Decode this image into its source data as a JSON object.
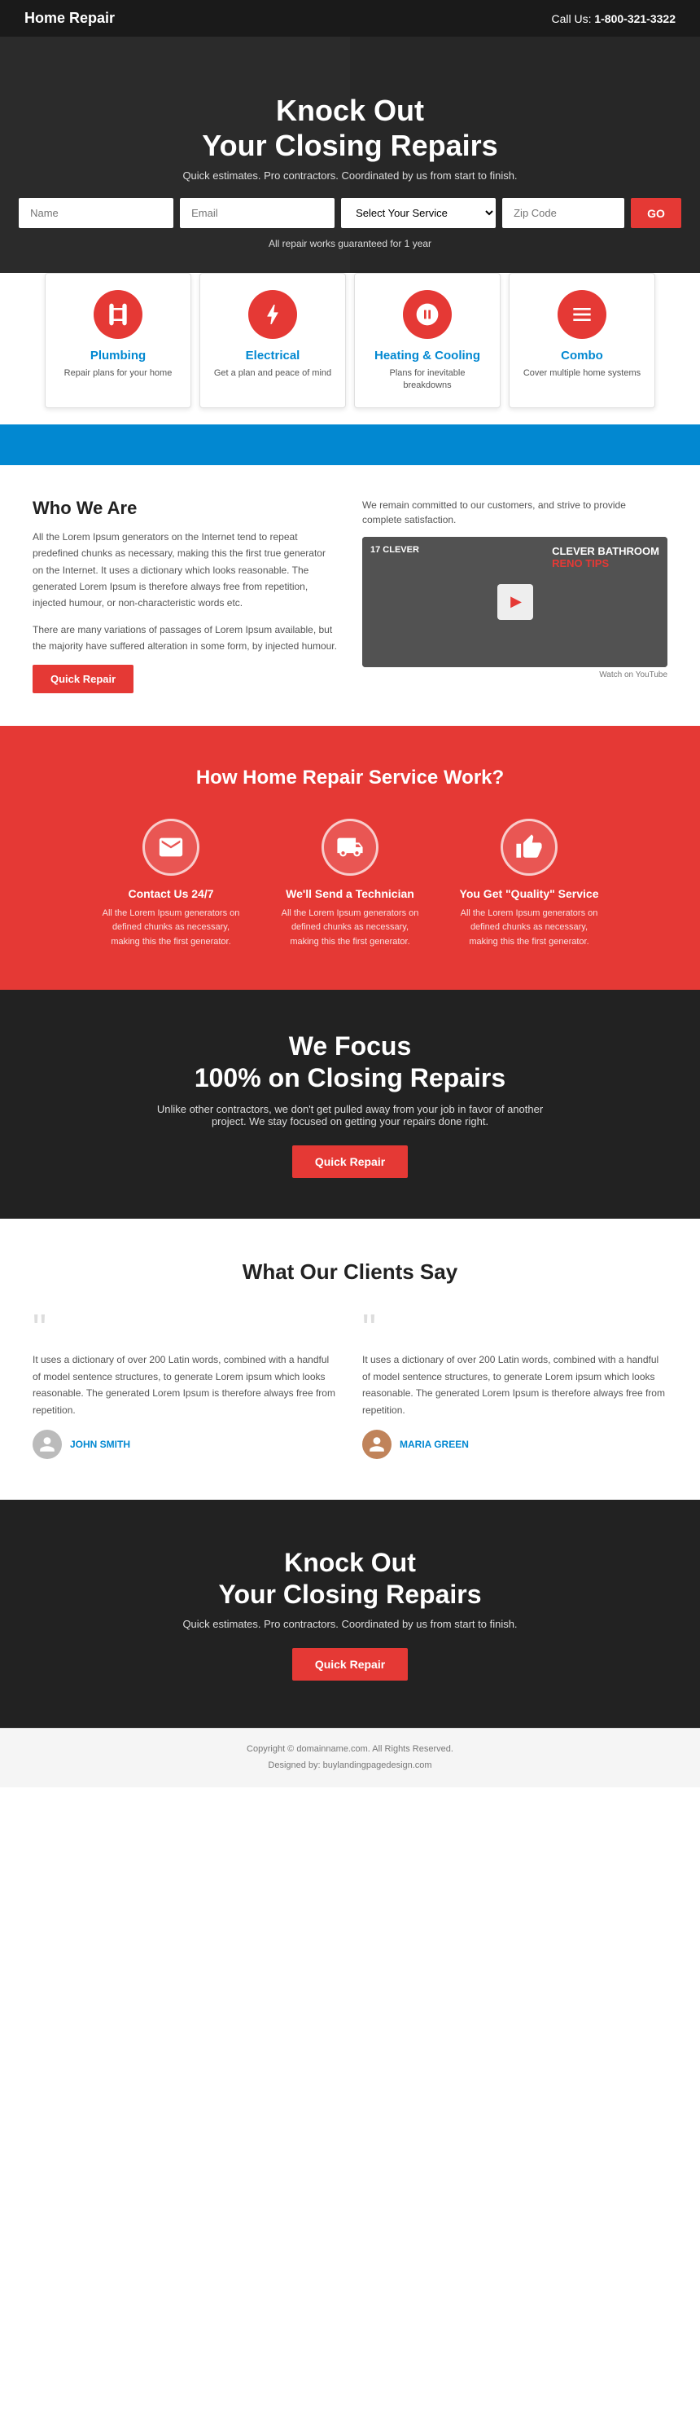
{
  "header": {
    "logo": "Home Repair",
    "phone_label": "Call Us:",
    "phone": "1-800-321-3322"
  },
  "hero": {
    "title_line1": "Knock Out",
    "title_line2": "Your Closing Repairs",
    "subtitle": "Quick estimates. Pro contractors. Coordinated by us from start to finish.",
    "name_placeholder": "Name",
    "email_placeholder": "Email",
    "service_placeholder": "Select Your Service",
    "zip_placeholder": "Zip Code",
    "go_label": "GO",
    "guarantee": "All repair works guaranteed for 1 year"
  },
  "services": [
    {
      "title": "Plumbing",
      "desc": "Repair plans for your home",
      "icon": "plumbing"
    },
    {
      "title": "Electrical",
      "desc": "Get a plan and peace of mind",
      "icon": "electrical"
    },
    {
      "title": "Heating & Cooling",
      "desc": "Plans for inevitable breakdowns",
      "icon": "hvac"
    },
    {
      "title": "Combo",
      "desc": "Cover multiple home systems",
      "icon": "combo"
    }
  ],
  "who": {
    "title": "Who We Are",
    "para1": "All the Lorem Ipsum generators on the Internet tend to repeat predefined chunks as necessary, making this the first true generator on the Internet. It uses a dictionary which looks reasonable. The generated Lorem Ipsum is therefore always free from repetition, injected humour, or non-characteristic words etc.",
    "para2": "There are many variations of passages of Lorem Ipsum available, but the majority have suffered alteration in some form, by injected humour.",
    "btn_label": "Quick Repair",
    "right_text": "We remain committed to our customers, and strive to provide complete satisfaction.",
    "video_label": "17 Clever",
    "video_reno": "RENO TIPS",
    "video_footer": "Watch on YouTube"
  },
  "how": {
    "title": "How Home Repair Service Work?",
    "steps": [
      {
        "title": "Contact Us 24/7",
        "desc": "All the Lorem Ipsum generators on defined chunks as necessary, making this the first generator.",
        "icon": "envelope"
      },
      {
        "title": "We'll Send a Technician",
        "desc": "All the Lorem Ipsum generators on defined chunks as necessary, making this the first generator.",
        "icon": "truck"
      },
      {
        "title": "You Get \"Quality\" Service",
        "desc": "All the Lorem Ipsum generators on defined chunks as necessary, making this the first generator.",
        "icon": "thumbsup"
      }
    ]
  },
  "focus": {
    "title_line1": "We Focus",
    "title_line2": "100% on Closing Repairs",
    "desc": "Unlike other contractors, we don't get pulled away from your job in favor of another project. We stay focused on getting your repairs done right.",
    "btn_label": "Quick Repair"
  },
  "testimonials": {
    "title": "What Our Clients Say",
    "items": [
      {
        "text": "It uses a dictionary of over 200 Latin words, combined with a handful of model sentence structures, to generate Lorem ipsum which looks reasonable. The generated Lorem Ipsum is therefore always free from repetition.",
        "author": "John Smith"
      },
      {
        "text": "It uses a dictionary of over 200 Latin words, combined with a handful of model sentence structures, to generate Lorem ipsum which looks reasonable. The generated Lorem Ipsum is therefore always free from repetition.",
        "author": "Maria Green"
      }
    ]
  },
  "bottom_hero": {
    "title_line1": "Knock Out",
    "title_line2": "Your Closing Repairs",
    "subtitle": "Quick estimates. Pro contractors. Coordinated by us from start to finish.",
    "btn_label": "Quick Repair"
  },
  "footer": {
    "line1": "Copyright © domainname.com. All Rights Reserved.",
    "line2": "Designed by: buylandingpagedesign.com"
  }
}
